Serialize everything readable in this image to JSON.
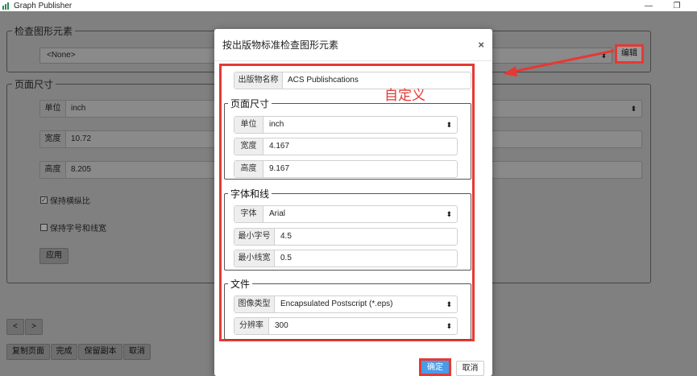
{
  "window": {
    "title": "Graph Publisher",
    "minimize_glyph": "—",
    "restore_glyph": "❐"
  },
  "background": {
    "inspect_legend": "检查图形元素",
    "inspect_select_value": "<None>",
    "edit_button": "编辑",
    "page_size_legend": "页面尺寸",
    "unit_label": "单位",
    "unit_value": "inch",
    "width_label": "宽度",
    "width_value": "10.72",
    "height_label": "高度",
    "height_value": "8.205",
    "keep_aspect_label": "保持横纵比",
    "keep_aspect_checked": true,
    "keep_font_label": "保持字号和线宽",
    "keep_font_checked": false,
    "apply_button": "应用",
    "nav_prev_glyph": "<",
    "nav_next_glyph": ">",
    "footer_buttons": [
      "复制页面",
      "完成",
      "保留副本",
      "取消"
    ]
  },
  "dialog": {
    "title": "按出版物标准检查图形元素",
    "close_glyph": "×",
    "publication_label": "出版物名称",
    "publication_value": "ACS Publishcations",
    "annotation": "自定义",
    "page_size": {
      "title": "页面尺寸",
      "unit_label": "单位",
      "unit_value": "inch",
      "width_label": "宽度",
      "width_value": "4.167",
      "height_label": "高度",
      "height_value": "9.167"
    },
    "font_line": {
      "title": "字体和线",
      "font_label": "字体",
      "font_value": "Arial",
      "min_font_label": "最小字号",
      "min_font_value": "4.5",
      "min_line_label": "最小线宽",
      "min_line_value": "0.5"
    },
    "file": {
      "title": "文件",
      "image_type_label": "图像类型",
      "image_type_value": "Encapsulated Postscript (*.eps)",
      "resolution_label": "分辨率",
      "resolution_value": "300"
    },
    "ok_button": "确定",
    "cancel_button": "取消"
  },
  "colors": {
    "highlight": "#e53935",
    "primary": "#4a9be8"
  }
}
